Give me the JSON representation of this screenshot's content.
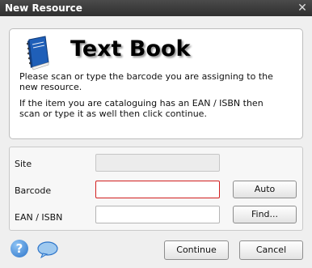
{
  "window": {
    "title": "New Resource",
    "close_glyph": "✕"
  },
  "header": {
    "title": "Text Book",
    "instruction_1": "Please scan or type the barcode you are assigning to the new resource.",
    "instruction_2": "If the item you are cataloguing has an EAN / ISBN then scan or type it as well then click continue."
  },
  "form": {
    "site": {
      "label": "Site",
      "value": ""
    },
    "barcode": {
      "label": "Barcode",
      "value": ""
    },
    "ean_isbn": {
      "label": "EAN / ISBN",
      "value": ""
    },
    "auto_label": "Auto",
    "find_label": "Find..."
  },
  "footer": {
    "help_glyph": "?",
    "continue_label": "Continue",
    "cancel_label": "Cancel"
  },
  "colors": {
    "error_border": "#d21f1f",
    "titlebar": "#3a3a3a",
    "accent_blue": "#2c74c9"
  },
  "icons": {
    "book": "book-icon",
    "help": "help-icon",
    "chat": "chat-bubble-icon"
  }
}
